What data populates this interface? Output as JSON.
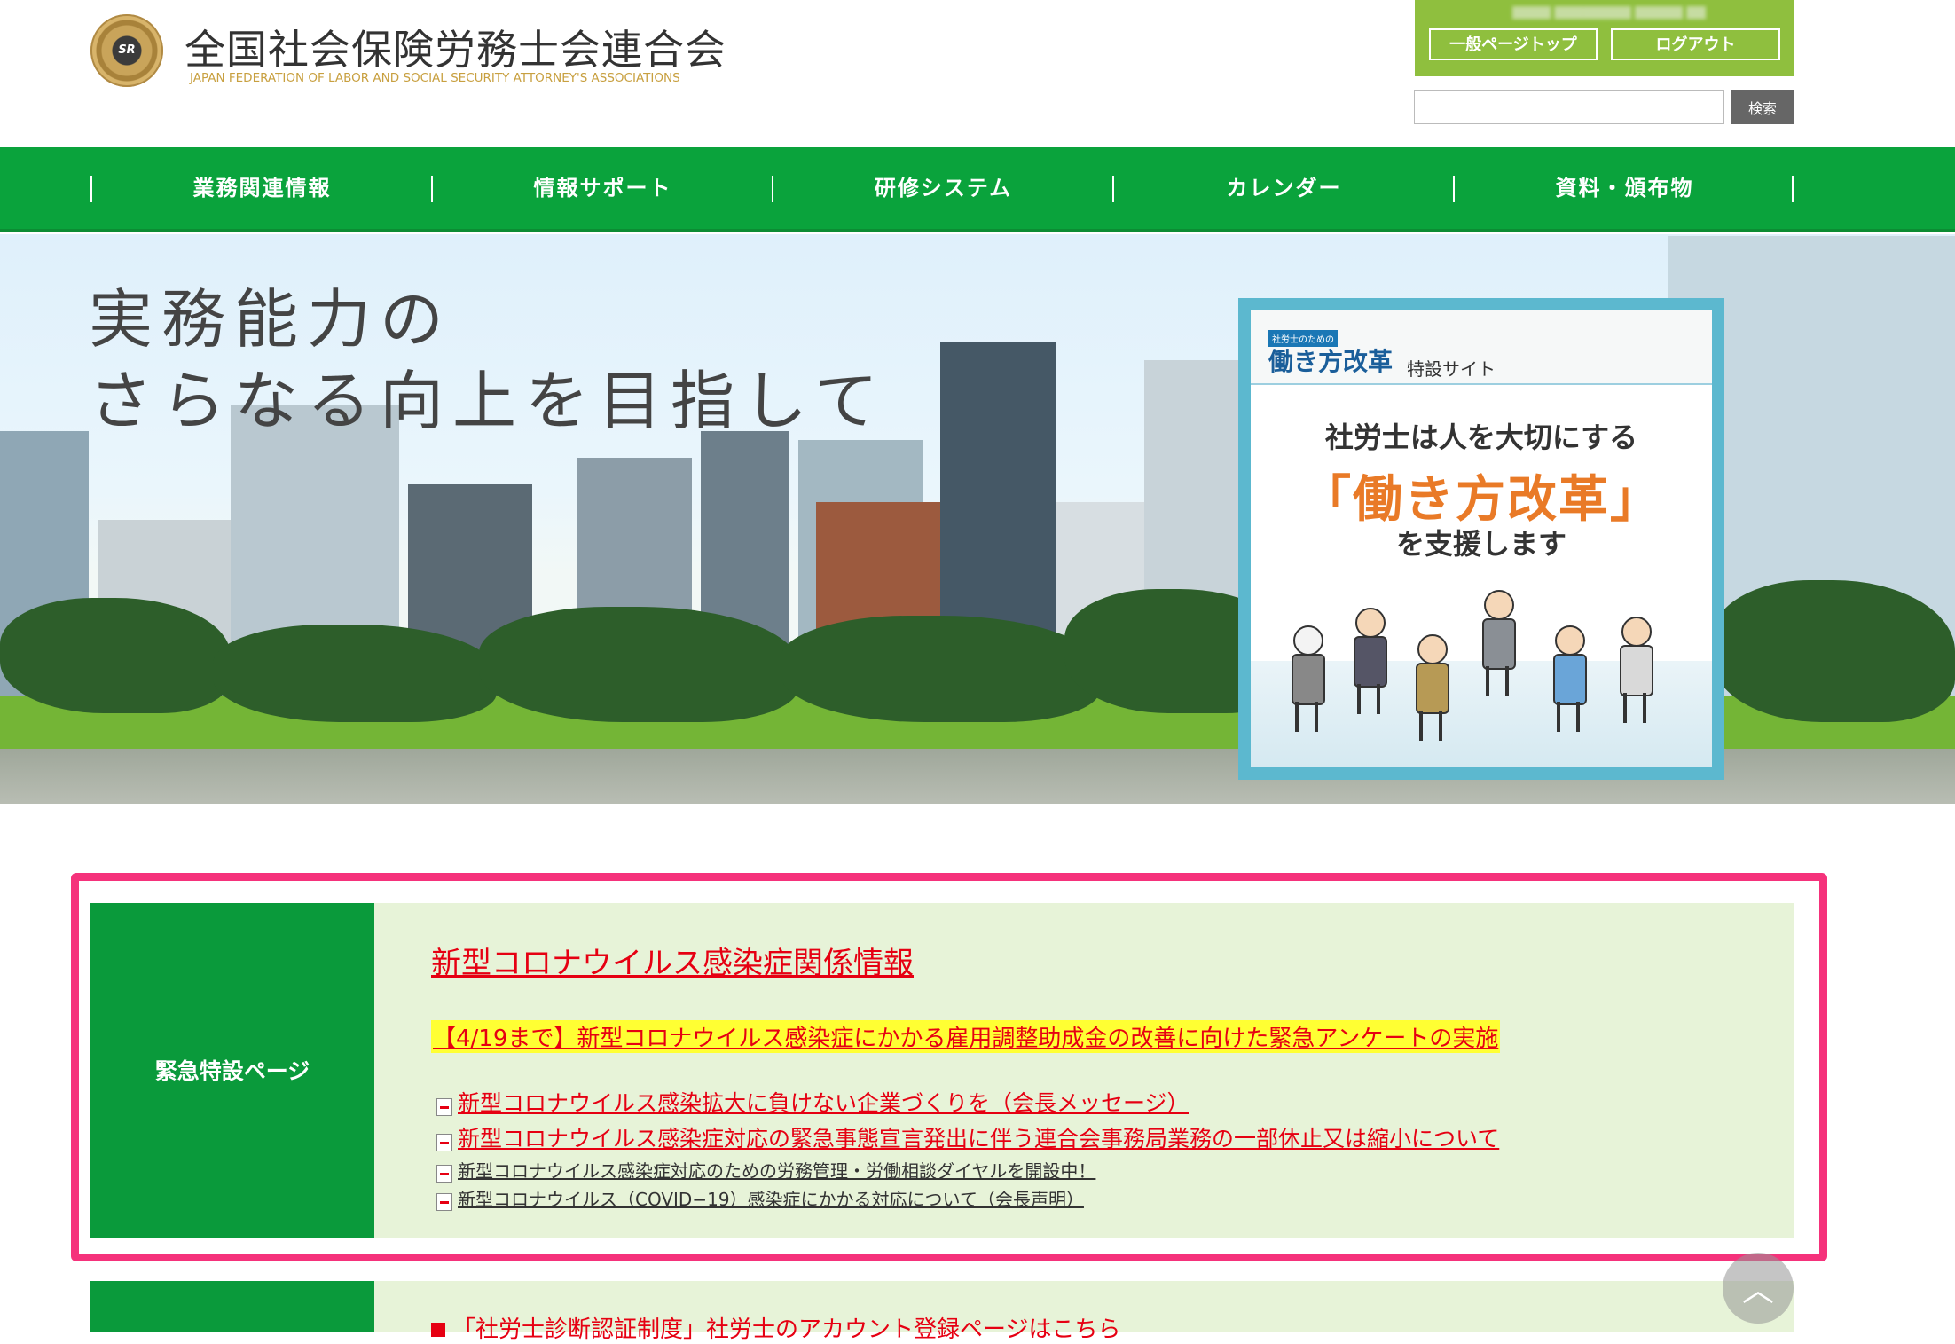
{
  "header": {
    "org_name": "全国社会保険労務士会連合会",
    "org_subtitle": "JAPAN FEDERATION OF LABOR AND SOCIAL SECURITY ATTORNEY'S ASSOCIATIONS",
    "emblem_text": "SR",
    "account": {
      "general_top_label": "一般ページトップ",
      "logout_label": "ログアウト"
    },
    "search": {
      "input_value": "",
      "button_label": "検索"
    }
  },
  "nav": {
    "items": [
      {
        "label": "業務関連情報"
      },
      {
        "label": "情報サポート"
      },
      {
        "label": "研修システム"
      },
      {
        "label": "カレンダー"
      },
      {
        "label": "資料・頒布物"
      }
    ]
  },
  "hero": {
    "title_line1": "実務能力の",
    "title_line2": "さらなる向上を目指して",
    "promo": {
      "small_label": "社労士のための",
      "main_label": "働き方改革",
      "site_label": "特設サイト",
      "line1": "社労士は人を大切にする",
      "line2": "「働き方改革」",
      "line3": "を支援します"
    }
  },
  "emergency": {
    "section_label": "緊急特設ページ",
    "title": "新型コロナウイルス感染症関係情報",
    "highlight": "【4/19まで】新型コロナウイルス感染症にかかる雇用調整助成金の改善に向けた緊急アンケートの実施",
    "links": [
      {
        "text": "新型コロナウイルス感染拡大に負けない企業づくりを（会長メッセージ）",
        "style": "big"
      },
      {
        "text": "新型コロナウイルス感染症対応の緊急事態宣言発出に伴う連合会事務局業務の一部休止又は縮小について",
        "style": "big"
      },
      {
        "text": "新型コロナウイルス感染症対応のための労務管理・労働相談ダイヤルを開設中！",
        "style": "small"
      },
      {
        "text": "新型コロナウイルス（COVID−19）感染症にかかる対応について（会長声明）",
        "style": "small"
      }
    ]
  },
  "next_section": {
    "text": "「社労士診断認証制度」社労士のアカウント登録ページはこちら"
  },
  "colors": {
    "nav_green": "#0aa33c",
    "account_green": "#8fbf3e",
    "alert_red": "#e60012",
    "frame_pink": "#f5327b",
    "highlight_yellow": "#ffff33",
    "panel_bg": "#e7f3d8"
  },
  "icons": {
    "pagetop": "chevron-up-icon",
    "link_bullet": "document-icon"
  }
}
